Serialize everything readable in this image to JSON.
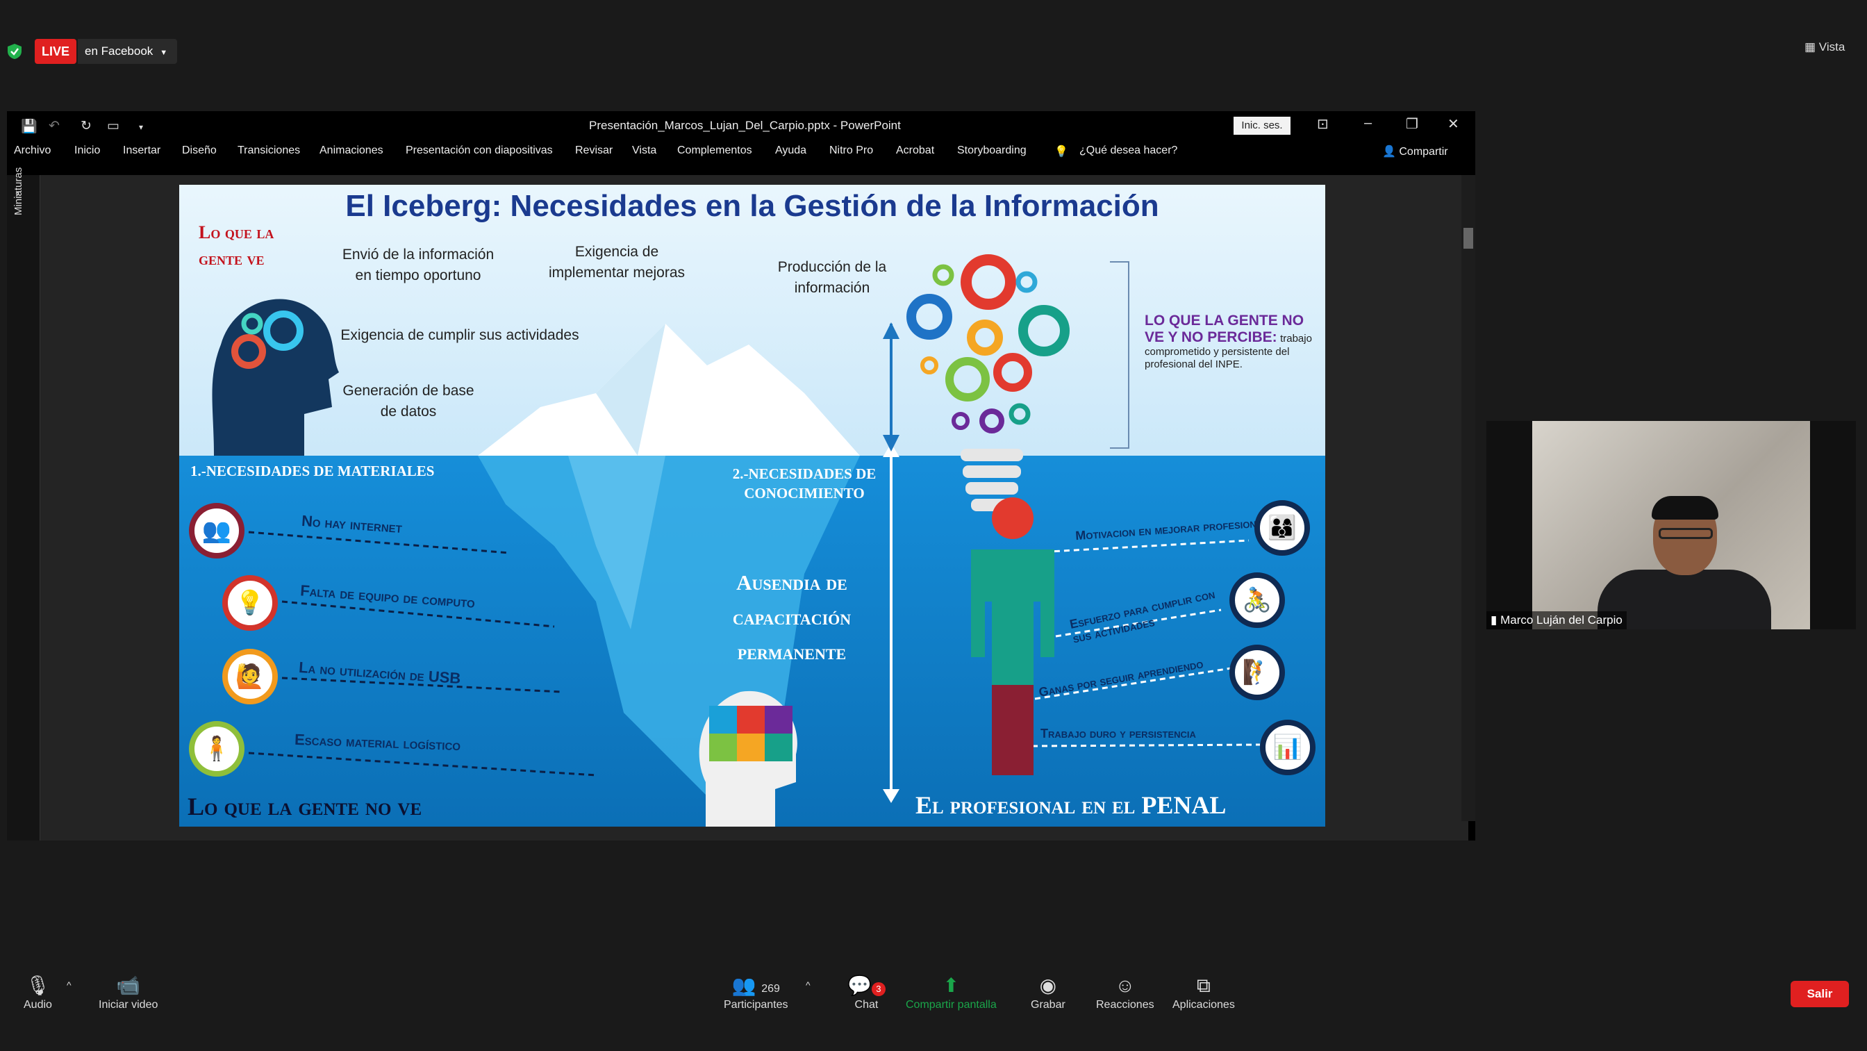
{
  "live": {
    "badge": "LIVE",
    "destination": "en Facebook"
  },
  "view_label": "Vista",
  "powerpoint": {
    "doc_title": "Presentación_Marcos_Lujan_Del_Carpio.pptx  -  PowerPoint",
    "login_label": "Inic. ses.",
    "menu": [
      "Archivo",
      "Inicio",
      "Insertar",
      "Diseño",
      "Transiciones",
      "Animaciones",
      "Presentación con diapositivas",
      "Revisar",
      "Vista",
      "Complementos",
      "Ayuda",
      "Nitro Pro",
      "Acrobat",
      "Storyboarding",
      "¿Qué desea hacer?"
    ],
    "share_label": "Compartir",
    "thumbnails_label": "Miniaturas"
  },
  "slide": {
    "title": "El Iceberg: Necesidades en la Gestión de la Información",
    "left_heading": [
      "Lo que la",
      "gente ve"
    ],
    "visible_items": [
      "Envió de la información en tiempo oportuno",
      "Exigencia de implementar mejoras",
      "Producción de la información",
      "Exigencia de cumplir sus actividades",
      "Generación de base de datos"
    ],
    "purple_note_title": "LO QUE LA GENTE NO VE Y NO PERCIBE:",
    "purple_note_text": "trabajo comprometido y persistente del profesional del INPE.",
    "section1": "1.-NECESIDADES DE MATERIALES",
    "section2": [
      "2.-NECESIDADES DE",
      "CONOCIMIENTO"
    ],
    "material_needs": [
      "No hay internet",
      "Falta de equipo de computo",
      "La no utilización de USB",
      "Escaso material logístico"
    ],
    "ausencia": [
      "Ausendia de",
      "capacitación",
      "permanente"
    ],
    "professional_items": [
      "Motivacion en mejorar profesionalmente",
      "Esfuerzo para cumplir con sus actividades",
      "Ganas por seguir aprendiendo",
      "Trabajo duro y persistencia"
    ],
    "bottom_left": "Lo que la gente no ve",
    "bottom_right": "El profesional en el PENAL"
  },
  "participant": {
    "name": "Marco Luján del Carpio"
  },
  "toolbar": {
    "audio": "Audio",
    "video": "Iniciar video",
    "participants": "Participantes",
    "participants_count": "269",
    "chat": "Chat",
    "chat_badge": "3",
    "share": "Compartir pantalla",
    "record": "Grabar",
    "reactions": "Reacciones",
    "apps": "Aplicaciones",
    "exit": "Salir"
  },
  "colors": {
    "live_red": "#e02020",
    "share_green": "#1aa64a",
    "slide_title_blue": "#1a3a8f",
    "slide_red": "#c3121c",
    "note_purple": "#6b2a99"
  }
}
